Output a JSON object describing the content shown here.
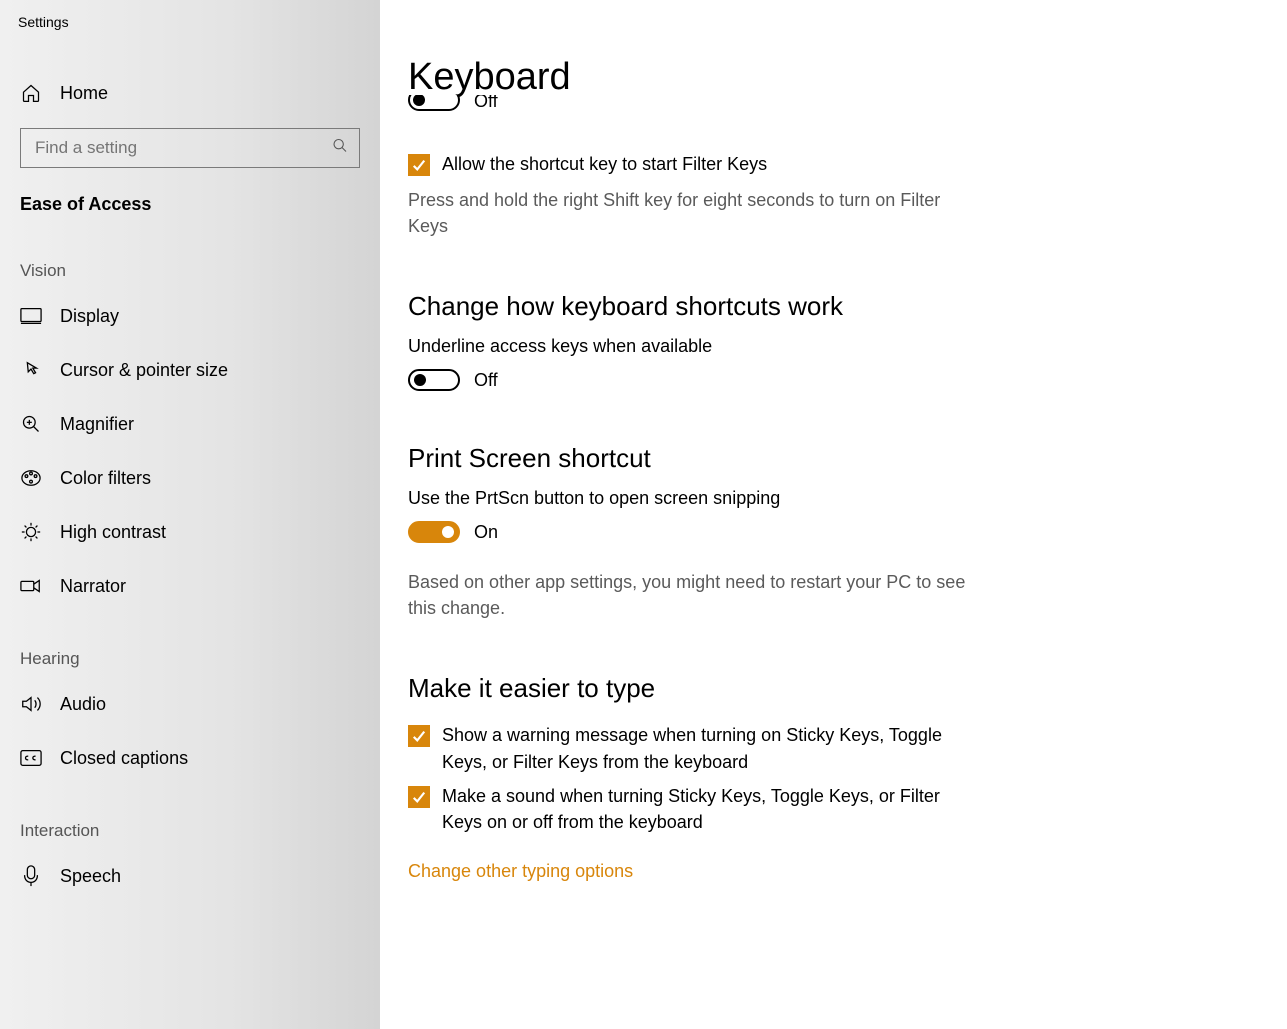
{
  "app_title": "Settings",
  "sidebar": {
    "home_label": "Home",
    "search_placeholder": "Find a setting",
    "section_title": "Ease of Access",
    "groups": [
      {
        "label": "Vision",
        "items": [
          {
            "icon": "display-icon",
            "label": "Display"
          },
          {
            "icon": "cursor-icon",
            "label": "Cursor & pointer size"
          },
          {
            "icon": "magnifier-icon",
            "label": "Magnifier"
          },
          {
            "icon": "color-filters-icon",
            "label": "Color filters"
          },
          {
            "icon": "high-contrast-icon",
            "label": "High contrast"
          },
          {
            "icon": "narrator-icon",
            "label": "Narrator"
          }
        ]
      },
      {
        "label": "Hearing",
        "items": [
          {
            "icon": "audio-icon",
            "label": "Audio"
          },
          {
            "icon": "closed-captions-icon",
            "label": "Closed captions"
          }
        ]
      },
      {
        "label": "Interaction",
        "items": [
          {
            "icon": "speech-icon",
            "label": "Speech"
          }
        ]
      }
    ]
  },
  "main": {
    "title": "Keyboard",
    "top_partial": {
      "toggle_state": "Off",
      "checkbox_label": "Allow the shortcut key to start Filter Keys",
      "desc": "Press and hold the right Shift key for eight seconds to turn on Filter Keys"
    },
    "shortcuts_section": {
      "heading": "Change how keyboard shortcuts work",
      "setting_label": "Underline access keys when available",
      "toggle_state": "Off"
    },
    "prtscn_section": {
      "heading": "Print Screen shortcut",
      "setting_label": "Use the PrtScn button to open screen snipping",
      "toggle_state": "On",
      "desc": "Based on other app settings, you might need to restart your PC to see this change."
    },
    "easier_section": {
      "heading": "Make it easier to type",
      "checks": [
        "Show a warning message when turning on Sticky Keys, Toggle Keys, or Filter Keys from the keyboard",
        "Make a sound when turning Sticky Keys, Toggle Keys, or Filter Keys on or off from the keyboard"
      ],
      "link": "Change other typing options"
    }
  },
  "colors": {
    "accent": "#d8860b"
  }
}
